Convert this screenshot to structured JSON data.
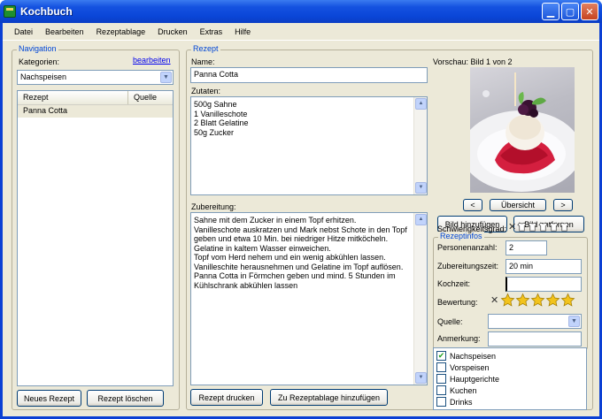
{
  "window": {
    "title": "Kochbuch"
  },
  "menu": [
    "Datei",
    "Bearbeiten",
    "Rezeptablage",
    "Drucken",
    "Extras",
    "Hilfe"
  ],
  "navigation": {
    "group_label": "Navigation",
    "kategorien_label": "Kategorien:",
    "edit_link": "bearbeiten",
    "category_value": "Nachspeisen",
    "columns": [
      "Rezept",
      "Quelle"
    ],
    "rows": [
      {
        "rezept": "Panna Cotta",
        "quelle": ""
      }
    ],
    "new_button": "Neues Rezept",
    "delete_button": "Rezept löschen"
  },
  "recipe": {
    "group_label": "Rezept",
    "name_label": "Name:",
    "name_value": "Panna Cotta",
    "ingredients_label": "Zutaten:",
    "ingredients": [
      "500g Sahne",
      "1 Vanilleschote",
      "2 Blatt Gelatine",
      "50g Zucker"
    ],
    "preparation_label": "Zubereitung:",
    "preparation": [
      "Sahne mit dem Zucker in einem Topf erhitzen.",
      "Vanilleschote auskratzen und Mark nebst Schote in den Topf",
      "geben und etwa 10 Min. bei niedriger Hitze mitköcheln.",
      "Gelatine in kaltem Wasser einweichen.",
      "Topf vom Herd nehem und ein wenig abkühlen lassen.",
      "Vanilleschite herausnehmen und Gelatine im Topf auflösen.",
      "Panna Cotta in Förmchen geben und mind. 5 Stunden im",
      "Kühlschrank abkühlen lassen"
    ],
    "print_button": "Rezept drucken",
    "add_to_storage_button": "Zu Rezeptablage hinzufügen"
  },
  "preview": {
    "label": "Vorschau: Bild 1 von 2",
    "prev_button": "<",
    "overview_button": "Übersicht",
    "next_button": ">",
    "add_image_button": "Bild hinzufügen",
    "remove_image_button": "Bild entfernen"
  },
  "info": {
    "group_label": "Rezeptinfos",
    "difficulty_label": "Schwierigkeitsgrad:",
    "difficulty_level": 0,
    "difficulty_max": 5,
    "persons_label": "Personenanzahl:",
    "persons_value": "2",
    "prep_time_label": "Zubereitungszeit:",
    "prep_time_value": "20 min",
    "cook_time_label": "Kochzeit:",
    "cook_time_value": "",
    "rating_label": "Bewertung:",
    "rating_value": 5,
    "rating_max": 5,
    "source_label": "Quelle:",
    "source_value": "",
    "note_label": "Anmerkung:",
    "note_value": ""
  },
  "categories": [
    {
      "label": "Nachspeisen",
      "checked": true
    },
    {
      "label": "Vorspeisen",
      "checked": false
    },
    {
      "label": "Hauptgerichte",
      "checked": false
    },
    {
      "label": "Kuchen",
      "checked": false
    },
    {
      "label": "Drinks",
      "checked": false
    }
  ],
  "colors": {
    "title_bar": "#0a46d8",
    "group_label": "#0046d5",
    "star": "#f2c31c",
    "check": "#21a121"
  }
}
